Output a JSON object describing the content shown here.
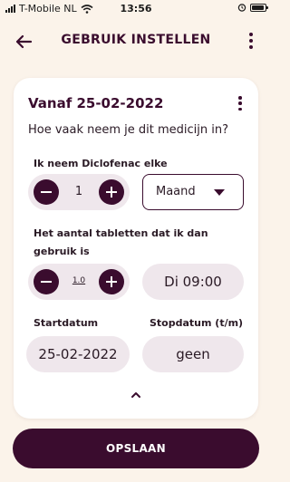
{
  "status_bar": {
    "carrier": "T-Mobile NL",
    "time": "13:56"
  },
  "app_bar": {
    "title": "GEBRUIK INSTELLEN"
  },
  "card": {
    "title": "Vanaf 25-02-2022",
    "question": "Hoe vaak neem je dit medicijn in?",
    "frequency": {
      "label": "Ik neem Diclofenac elke",
      "count": "1",
      "unit": "Maand"
    },
    "tablets": {
      "label": "Het aantal tabletten dat ik dan gebruik is",
      "amount": "1.0",
      "time": "Di 09:00"
    },
    "start": {
      "label": "Startdatum",
      "value": "25-02-2022"
    },
    "stop": {
      "label": "Stopdatum (t/m)",
      "value": "geen"
    }
  },
  "save_label": "OPSLAAN",
  "colors": {
    "primary": "#3a0c2e",
    "background": "#fbf3ea",
    "field": "#efe7ec"
  }
}
